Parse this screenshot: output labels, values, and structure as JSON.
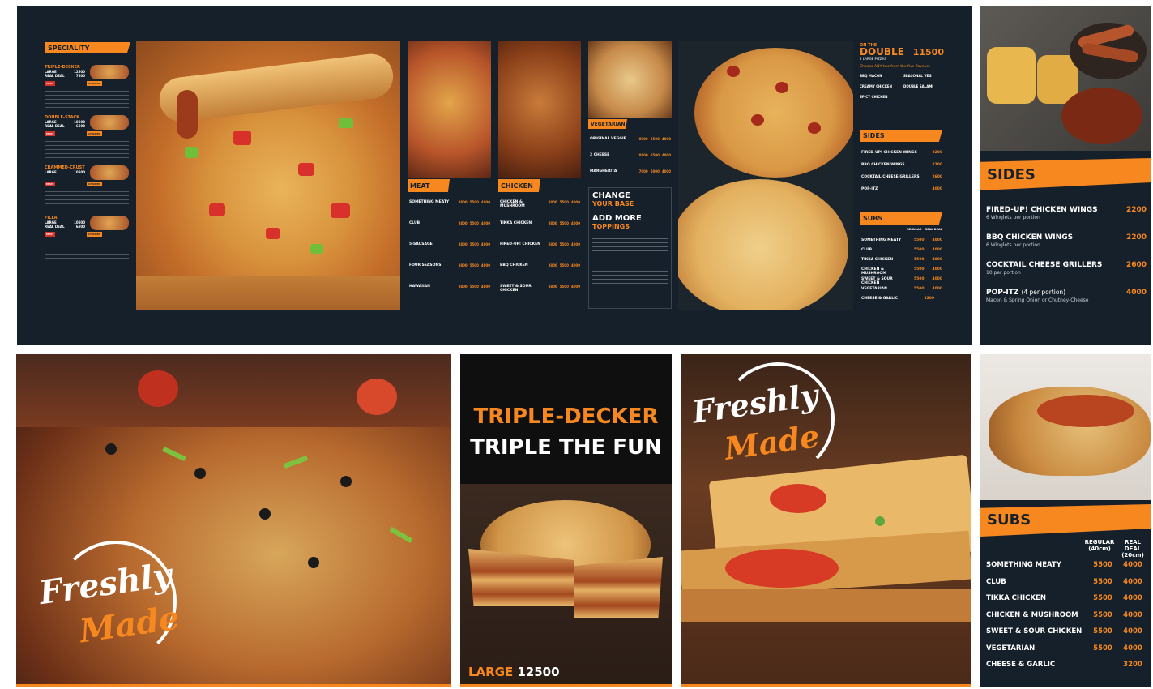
{
  "main_board": {
    "speciality": {
      "title": "SPECIALITY",
      "items": [
        {
          "name": "TRIPLE-DECKER",
          "large": "LARGE",
          "large_price": "12500",
          "deal": "REAL DEAL",
          "deal_price": "7800",
          "tag1": "MEAT",
          "tag2": "CHICKEN"
        },
        {
          "name": "DOUBLE-STACK",
          "large": "LARGE",
          "large_price": "10500",
          "deal": "REAL DEAL",
          "deal_price": "6500",
          "tag1": "MEAT",
          "tag2": "CHICKEN"
        },
        {
          "name": "CRAMMED-CRUST",
          "large": "LARGE",
          "large_price": "10500",
          "deal": "",
          "deal_price": "",
          "tag1": "MEAT",
          "tag2": "CHICKEN"
        },
        {
          "name": "FILLA",
          "large": "LARGE",
          "large_price": "10500",
          "deal": "REAL DEAL",
          "deal_price": "6500",
          "tag1": "MEAT",
          "tag2": "CHICKEN"
        }
      ]
    },
    "meat": {
      "title": "MEAT",
      "items": [
        {
          "name": "SOMETHING MEATY",
          "p1": "8800",
          "p2": "5500",
          "p3": "4000"
        },
        {
          "name": "CLUB",
          "p1": "8800",
          "p2": "5500",
          "p3": "4000"
        },
        {
          "name": "5-SAUSAGE",
          "p1": "8800",
          "p2": "5500",
          "p3": "4000"
        },
        {
          "name": "FOUR SEASONS",
          "p1": "8800",
          "p2": "5500",
          "p3": "4000"
        },
        {
          "name": "HAWAIIAN",
          "p1": "8800",
          "p2": "5500",
          "p3": "4000"
        }
      ]
    },
    "chicken": {
      "title": "CHICKEN",
      "items": [
        {
          "name": "CHICKEN & MUSHROOM",
          "p1": "8800",
          "p2": "5500",
          "p3": "4000"
        },
        {
          "name": "TIKKA CHICKEN",
          "p1": "8800",
          "p2": "5500",
          "p3": "4000"
        },
        {
          "name": "FIRED-UP! CHICKEN",
          "p1": "8800",
          "p2": "5500",
          "p3": "4000"
        },
        {
          "name": "BBQ CHICKEN",
          "p1": "8800",
          "p2": "5500",
          "p3": "4000"
        },
        {
          "name": "SWEET & SOUR CHICKEN",
          "p1": "8800",
          "p2": "5500",
          "p3": "4000"
        }
      ]
    },
    "vegetarian": {
      "title": "VEGETARIAN",
      "items": [
        {
          "name": "ORIGINAL VEGGIE",
          "p1": "8800",
          "p2": "5500",
          "p3": "4000"
        },
        {
          "name": "2 CHEESE",
          "p1": "8800",
          "p2": "5500",
          "p3": "4000"
        },
        {
          "name": "MARGHERITA",
          "p1": "7000",
          "p2": "5000",
          "p3": "4000"
        }
      ]
    },
    "change_base": {
      "line1": "CHANGE",
      "line2": "YOUR BASE"
    },
    "add_toppings": {
      "line1": "ADD MORE",
      "line2": "TOPPINGS"
    },
    "double": {
      "on_the": "ON THE",
      "word": "DOUBLE",
      "sub": "2 LARGE PIZZAS",
      "price": "11500",
      "choose": "Choose ANY two from the five flavours",
      "flavours": [
        "BBQ MACON",
        "SEASONAL VEG",
        "CREAMY CHICKEN",
        "DOUBLE SALAMI",
        "SPICY CHICKEN"
      ]
    },
    "sides_small": {
      "title": "SIDES",
      "items": [
        {
          "name": "FIRED-UP! CHICKEN WINGS",
          "price": "2200"
        },
        {
          "name": "BBQ CHICKEN WINGS",
          "price": "2200"
        },
        {
          "name": "COCKTAIL CHEESE GRILLERS",
          "price": "2600"
        },
        {
          "name": "POP-ITZ",
          "price": "4000"
        }
      ]
    },
    "subs_small": {
      "title": "SUBS",
      "col1": "REGULAR",
      "col2": "REAL DEAL",
      "items": [
        {
          "name": "SOMETHING MEATY",
          "p1": "5500",
          "p2": "4000"
        },
        {
          "name": "CLUB",
          "p1": "5500",
          "p2": "4000"
        },
        {
          "name": "TIKKA CHICKEN",
          "p1": "5500",
          "p2": "4000"
        },
        {
          "name": "CHICKEN & MUSHROOM",
          "p1": "5500",
          "p2": "4000"
        },
        {
          "name": "SWEET & SOUR CHICKEN",
          "p1": "5500",
          "p2": "4000"
        },
        {
          "name": "VEGETARIAN",
          "p1": "5500",
          "p2": "4000"
        },
        {
          "name": "CHEESE & GARLIC",
          "p1": "3200",
          "p2": ""
        }
      ]
    }
  },
  "sides_panel": {
    "title": "SIDES",
    "items": [
      {
        "name": "FIRED-UP! CHICKEN WINGS",
        "desc": "6 Winglets per portion",
        "price": "2200"
      },
      {
        "name": "BBQ CHICKEN WINGS",
        "desc": "6 Winglets per portion",
        "price": "2200"
      },
      {
        "name": "COCKTAIL CHEESE GRILLERS",
        "desc": "10 per portion",
        "price": "2600"
      },
      {
        "name": "POP-ITZ",
        "name_suffix": "(4 per portion)",
        "desc": "Macon & Spring Onion or Chutney-Cheese",
        "price": "4000"
      }
    ]
  },
  "subs_panel": {
    "title": "SUBS",
    "col1": "REGULAR",
    "col1_sub": "(40cm)",
    "col2": "REAL DEAL",
    "col2_sub": "(20cm)",
    "items": [
      {
        "name": "SOMETHING MEATY",
        "p1": "5500",
        "p2": "4000"
      },
      {
        "name": "CLUB",
        "p1": "5500",
        "p2": "4000"
      },
      {
        "name": "TIKKA CHICKEN",
        "p1": "5500",
        "p2": "4000"
      },
      {
        "name": "CHICKEN & MUSHROOM",
        "p1": "5500",
        "p2": "4000"
      },
      {
        "name": "SWEET & SOUR CHICKEN",
        "p1": "5500",
        "p2": "4000"
      },
      {
        "name": "VEGETARIAN",
        "p1": "5500",
        "p2": "4000"
      },
      {
        "name": "CHEESE & GARLIC",
        "p1": "",
        "p2": "3200"
      }
    ]
  },
  "poster_freshly": {
    "line1": "Freshly",
    "line2": "Made"
  },
  "poster_triple": {
    "line1": "TRIPLE-DECKER",
    "line2": "TRIPLE THE FUN",
    "large": "LARGE",
    "price": "12500"
  },
  "poster_freshly2": {
    "line1": "Freshly",
    "line2": "Made"
  },
  "colors": {
    "brand_orange": "#f7881f",
    "navy": "#15202b"
  }
}
